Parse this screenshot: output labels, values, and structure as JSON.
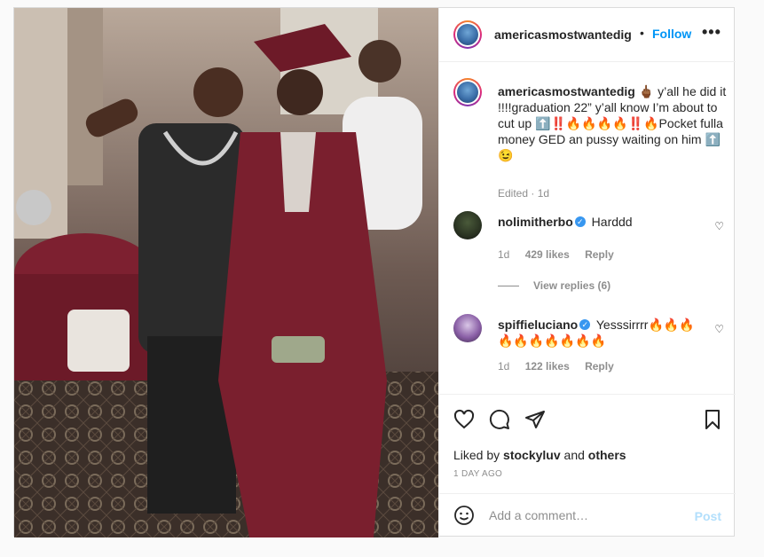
{
  "post": {
    "username": "americasmostwantedig",
    "follow_label": "Follow",
    "more_label": "•••",
    "caption": "y’all he did it !!!!graduation 22” y’all know I’m about to cut up ⬆️‼️🔥🔥🔥🔥‼️🔥Pocket fulla money GED an pussy waiting on him ⬆️😉",
    "caption_emoji_hand": "🖕🏾",
    "caption_meta": "Edited · 1d"
  },
  "comments": [
    {
      "username": "nolimitherbo",
      "verified": true,
      "text": "Harddd",
      "time": "1d",
      "likes": "429 likes",
      "reply": "Reply",
      "view_replies": "View replies (6)"
    },
    {
      "username": "spiffieluciano",
      "verified": true,
      "text": "Yesssirrrr🔥🔥🔥🔥🔥🔥🔥🔥🔥🔥",
      "time": "1d",
      "likes": "122 likes",
      "reply": "Reply"
    }
  ],
  "actions": {
    "liked_prefix": "Liked by",
    "liked_user": "stockyluv",
    "liked_and": "and",
    "liked_others": "others",
    "time_ago": "1 DAY AGO"
  },
  "add_comment": {
    "placeholder": "Add a comment…",
    "post_label": "Post"
  },
  "icons": {
    "like": "heart-icon",
    "comment": "comment-icon",
    "share": "paper-plane-icon",
    "save": "bookmark-icon",
    "emoji": "smiley-icon",
    "options": "ellipsis-icon",
    "verified": "verified-badge-icon"
  },
  "colors": {
    "link_blue": "#0095f6",
    "post_disabled": "#b2dffc",
    "verified": "#3897f0",
    "gown": "#7a1f2e"
  }
}
